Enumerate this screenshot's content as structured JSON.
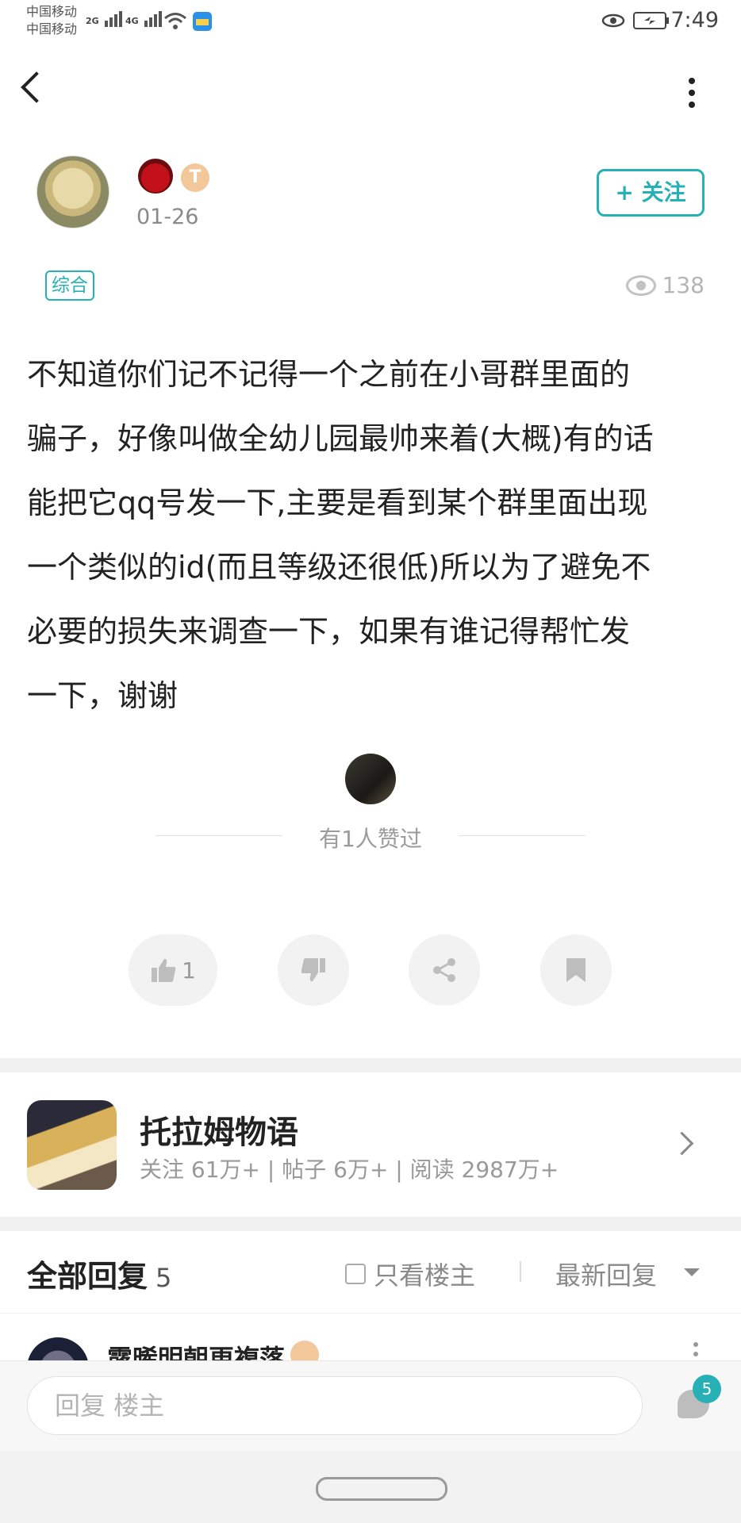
{
  "status_bar": {
    "carrier1": "中国移动",
    "carrier2": "中国移动",
    "net1": "2G",
    "net2": "4G",
    "time": "7:49"
  },
  "header": {
    "back_icon": "chevron-left-icon",
    "more_icon": "more-vertical-icon"
  },
  "author": {
    "date": "01-26",
    "level_badge": "T",
    "follow_label": "+ 关注"
  },
  "post": {
    "category": "综合",
    "views": "138",
    "body": "不知道你们记不记得一个之前在小哥群里面的\n骗子，好像叫做全幼儿园最帅来着(大概)有的话\n能把它qq号发一下,主要是看到某个群里面出现\n一个类似的id(而且等级还很低)所以为了避免不\n必要的损失来调查一下，如果有谁记得帮忙发\n一下，谢谢",
    "liked_text": "有1人赞过"
  },
  "actions": {
    "like_count": "1"
  },
  "forum": {
    "name": "托拉姆物语",
    "stats": "关注 61万+  |  帖子 6万+  |  阅读 2987万+"
  },
  "replies": {
    "title": "全部回复",
    "count": "5",
    "only_host": "只看楼主",
    "sort": "最新回复",
    "first_reply_name": "露晞明朝更複落"
  },
  "bottom_bar": {
    "reply_placeholder": "回复  楼主",
    "message_count": "5"
  },
  "colors": {
    "accent": "#27b0b6"
  }
}
